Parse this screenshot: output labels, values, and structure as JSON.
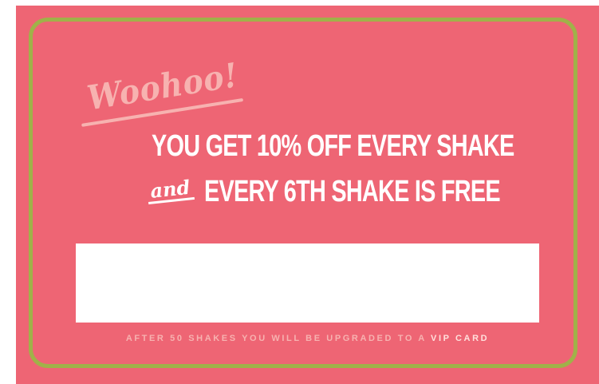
{
  "card": {
    "exclamation": "Woohoo!",
    "headline_line1": "YOU GET 10% OFF EVERY SHAKE",
    "connector": "and",
    "headline_line2": "EVERY 6TH SHAKE IS FREE",
    "footer_prefix": "AFTER 50 SHAKES YOU WILL BE UPGRADED TO A",
    "footer_emphasis": "VIP CARD"
  },
  "colors": {
    "background": "#ee6574",
    "border": "#a0b149",
    "accent_text": "#f7b2b0",
    "headline_text": "#ffffff",
    "name_box": "#ffffff"
  }
}
